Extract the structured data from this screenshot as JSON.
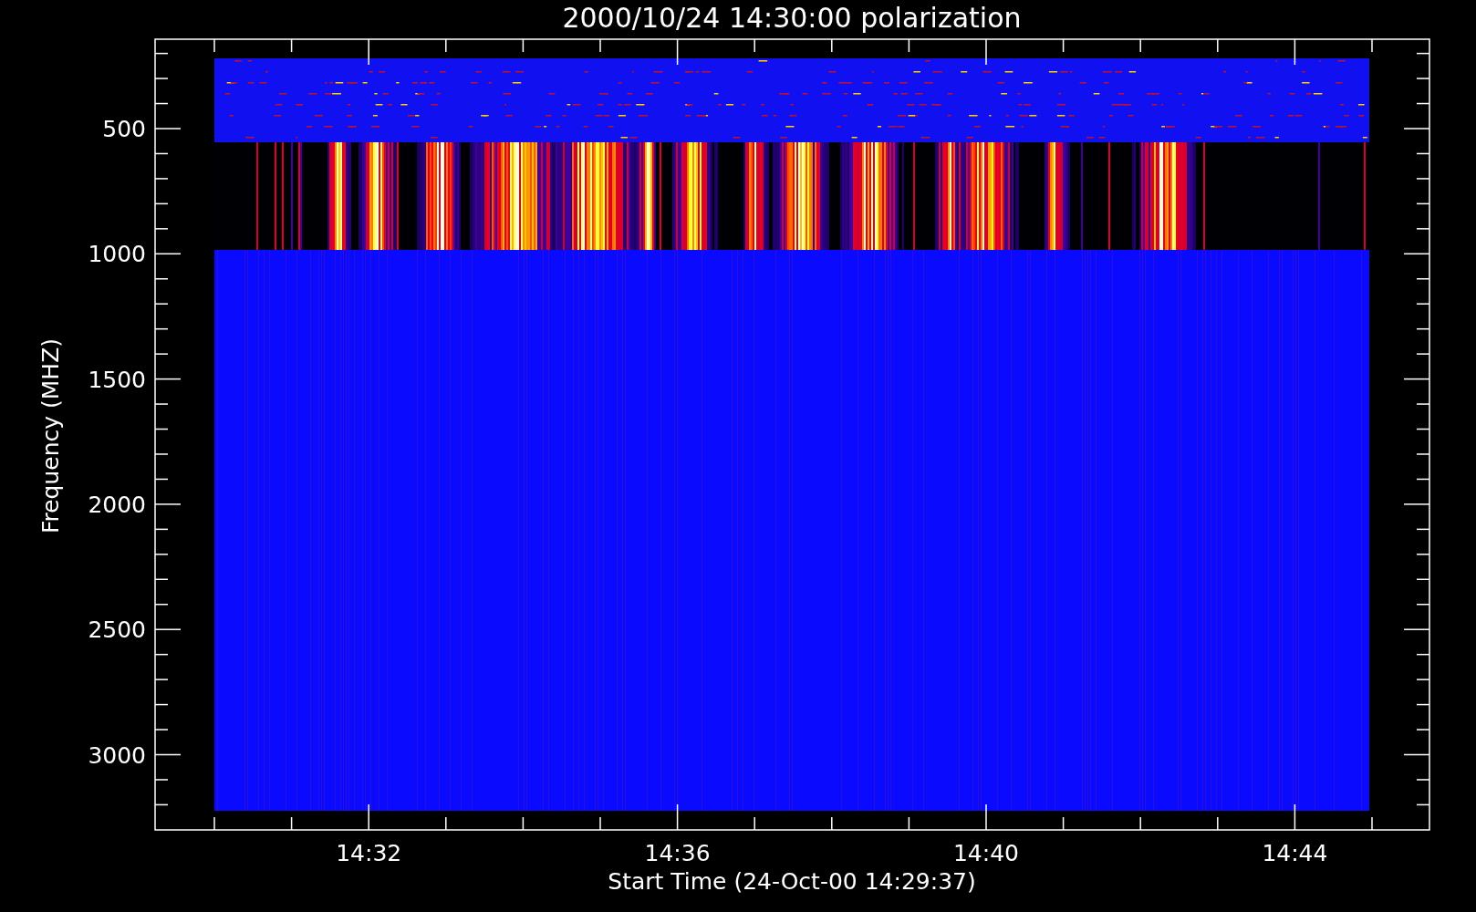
{
  "plot": {
    "title": "2000/10/24 14:30:00 polarization",
    "ylabel": "Frequency (MHZ)",
    "xlabel": "Start Time (24-Oct-00 14:29:37)",
    "yticks": [
      "500",
      "1000",
      "1500",
      "2000",
      "2500",
      "3000"
    ],
    "xticks": [
      "14:32",
      "14:36",
      "14:40",
      "14:44"
    ]
  }
}
